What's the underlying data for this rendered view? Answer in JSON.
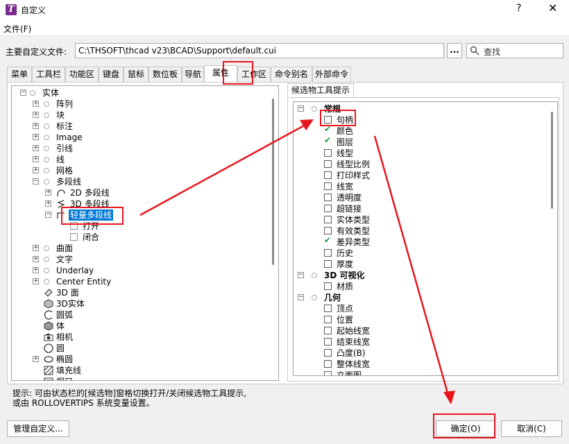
{
  "window": {
    "title": "自定义",
    "help": "?",
    "close": "✕"
  },
  "menu": {
    "file": "文件(F)"
  },
  "main_file": {
    "label": "主要自定义文件:",
    "path": "C:\\THSOFT\\thcad v23\\BCAD\\Support\\default.cui",
    "browse": "...",
    "search_placeholder": "查找"
  },
  "tabs": [
    "菜单",
    "工具栏",
    "功能区",
    "键盘",
    "鼠标",
    "数位板",
    "导航",
    "属性",
    "工作区",
    "命令别名",
    "外部命令"
  ],
  "active_tab": "属性",
  "left_tree": {
    "root": "实体",
    "items": [
      "阵列",
      "块",
      "标注",
      "Image",
      "引线",
      "线",
      "网格",
      "多段线"
    ],
    "polyline_children": [
      "2D 多段线",
      "3D 多段线",
      "轻量多段线"
    ],
    "lw_children": [
      "打开",
      "闭合"
    ],
    "items2": [
      "曲面",
      "文字",
      "Underlay",
      "Center Entity"
    ],
    "leaves": [
      "3D 面",
      "3D实体",
      "圆弧",
      "体",
      "相机",
      "圆",
      "椭圆",
      "填充线",
      "视口"
    ]
  },
  "right_panel": {
    "tab": "候选物工具提示",
    "groups": [
      {
        "name": "常规",
        "items": [
          {
            "label": "句柄",
            "checked": false
          },
          {
            "label": "颜色",
            "checked": true
          },
          {
            "label": "图层",
            "checked": true
          },
          {
            "label": "线型",
            "checked": false
          },
          {
            "label": "线型比例",
            "checked": false
          },
          {
            "label": "打印样式",
            "checked": false
          },
          {
            "label": "线宽",
            "checked": false
          },
          {
            "label": "透明度",
            "checked": false
          },
          {
            "label": "超链接",
            "checked": false
          },
          {
            "label": "实体类型",
            "checked": false
          },
          {
            "label": "有效类型",
            "checked": false
          },
          {
            "label": "差异类型",
            "checked": true
          },
          {
            "label": "历史",
            "checked": false
          },
          {
            "label": "厚度",
            "checked": false
          }
        ]
      },
      {
        "name": "3D 可视化",
        "items": [
          {
            "label": "材质",
            "checked": false
          }
        ]
      },
      {
        "name": "几何",
        "items": [
          {
            "label": "顶点",
            "checked": false
          },
          {
            "label": "位置",
            "checked": false
          },
          {
            "label": "起始线宽",
            "checked": false
          },
          {
            "label": "结束线宽",
            "checked": false
          },
          {
            "label": "凸度(B)",
            "checked": false
          },
          {
            "label": "整体线宽",
            "checked": false
          },
          {
            "label": "立面图",
            "checked": false
          }
        ]
      }
    ]
  },
  "hint": {
    "line1": "提示: 可由状态栏的[候选物]窗格切换打开/关闭候选物工具提示,",
    "line2": "或由 ROLLOVERTIPS 系统变量设置。"
  },
  "buttons": {
    "manage": "管理自定义...",
    "ok": "确定(O)",
    "cancel": "取消(C)"
  },
  "colors": {
    "annotation": "#e8141b",
    "selection": "#0078d7",
    "check": "#1a9c3c"
  }
}
